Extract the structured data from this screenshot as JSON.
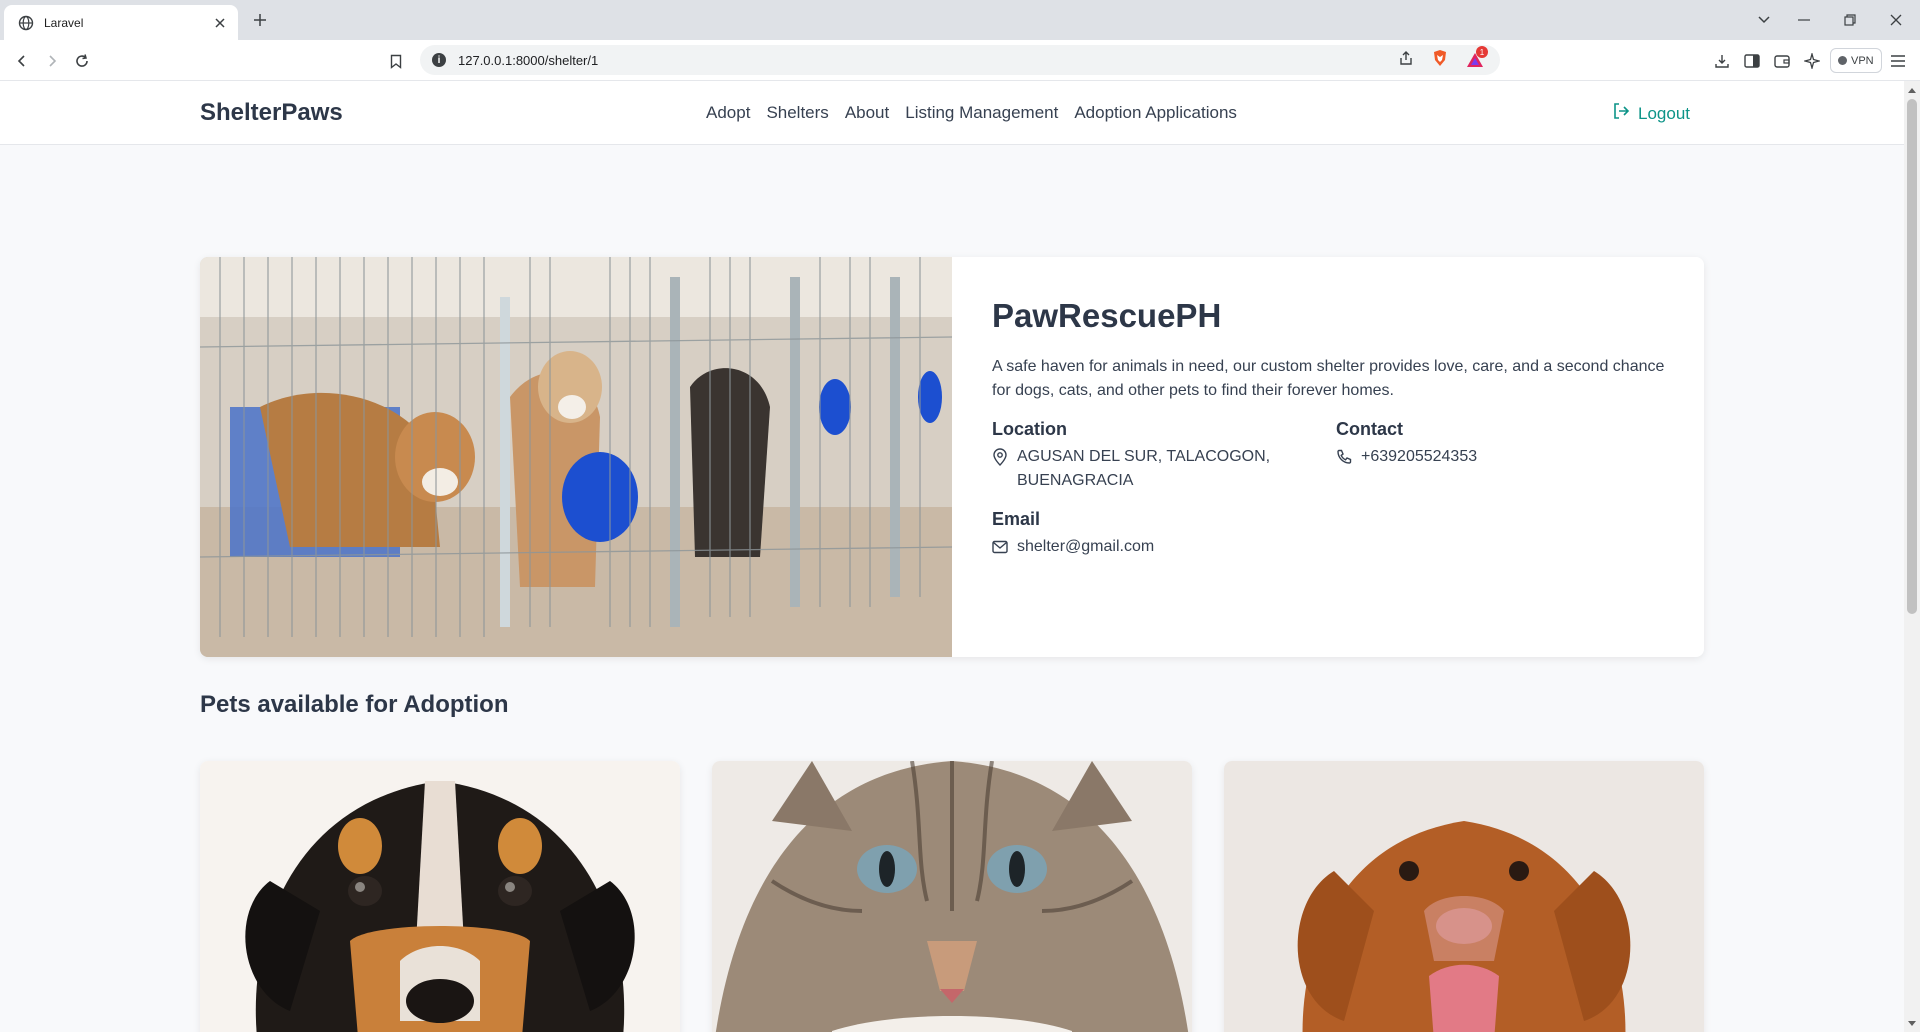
{
  "browser": {
    "tab_title": "Laravel",
    "url": "127.0.0.1:8000/shelter/1",
    "vpn_label": "VPN",
    "notification_count": "1"
  },
  "nav": {
    "brand": "ShelterPaws",
    "links": [
      "Adopt",
      "Shelters",
      "About",
      "Listing Management",
      "Adoption Applications"
    ],
    "logout": "Logout",
    "accent_color": "#0d9488"
  },
  "shelter": {
    "name": "PawRescuePH",
    "description": "A safe haven for animals in need, our custom shelter provides love, care, and a second chance for dogs, cats, and other pets to find their forever homes.",
    "location_label": "Location",
    "location_value": "AGUSAN DEL SUR, TALACOGON, BUENAGRACIA",
    "contact_label": "Contact",
    "contact_value": "+639205524353",
    "email_label": "Email",
    "email_value": "shelter@gmail.com"
  },
  "pets_section": {
    "title": "Pets available for Adoption"
  }
}
